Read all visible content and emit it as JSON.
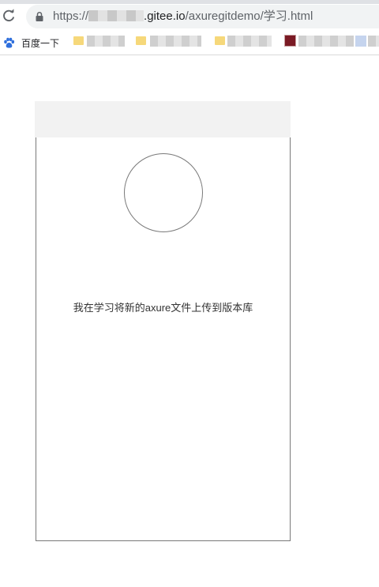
{
  "browser": {
    "url": {
      "scheme": "https://",
      "host_suffix": ".gitee.io",
      "path": "/axuregitdemo/学习.html"
    },
    "bookmarks": {
      "baidu_label": "百度一下"
    }
  },
  "page": {
    "caption": "我在学习将新的axure文件上传到版本库"
  },
  "colors": {
    "frame_border": "#797979",
    "header_fill": "#f2f2f2",
    "baidu_blue": "#2f6fdc"
  }
}
